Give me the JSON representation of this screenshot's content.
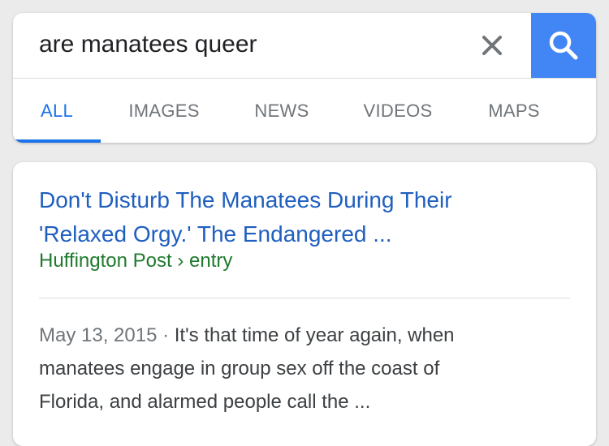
{
  "search": {
    "query": "are manatees queer",
    "clear_icon": "close-icon",
    "submit_icon": "search-icon",
    "accent_color": "#4285f4"
  },
  "tabs": [
    {
      "label": "ALL",
      "active": true
    },
    {
      "label": "IMAGES",
      "active": false
    },
    {
      "label": "NEWS",
      "active": false
    },
    {
      "label": "VIDEOS",
      "active": false
    },
    {
      "label": "MAPS",
      "active": false
    }
  ],
  "result": {
    "title_line1": "Don't Disturb The Manatees During Their",
    "title_line2": "'Relaxed Orgy.' The Endangered ...",
    "source": "Huffington Post › entry",
    "date": "May 13, 2015",
    "date_separator": " · ",
    "snippet_line1": "It's that time of year again, when",
    "snippet_line2": "manatees engage in group sex off the coast of",
    "snippet_line3": "Florida, and alarmed people call the ...",
    "title_color": "#1f5fbf",
    "source_color": "#1e7a2d"
  }
}
